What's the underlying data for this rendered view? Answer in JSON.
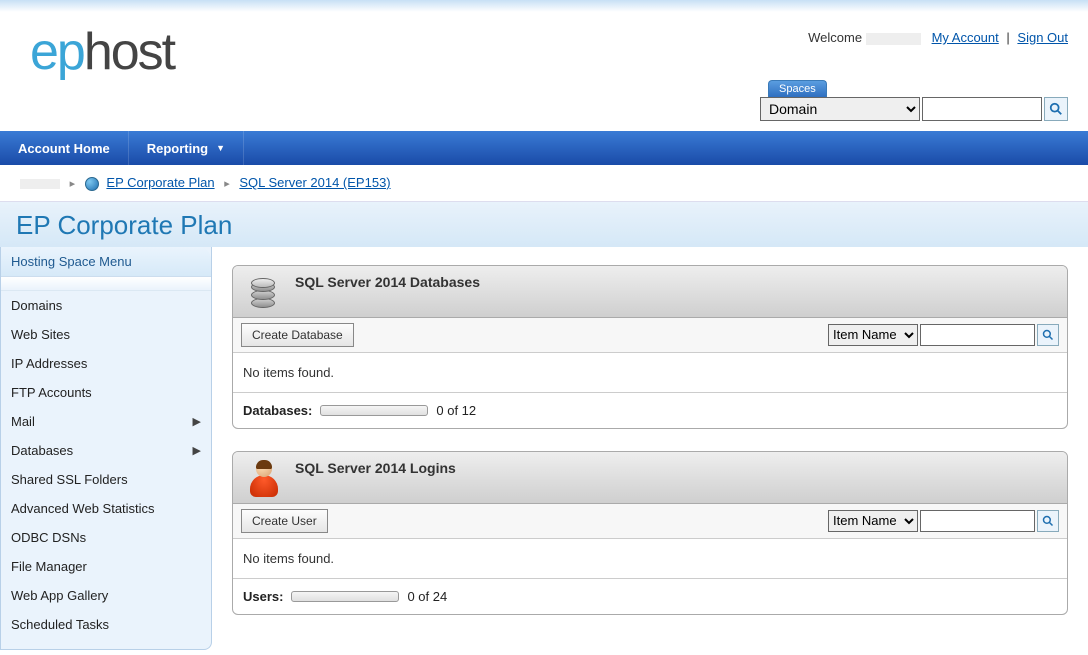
{
  "header": {
    "welcome": "Welcome",
    "my_account": "My Account",
    "sign_out": "Sign Out",
    "spaces_tab": "Spaces",
    "search_select_options": [
      "Domain"
    ],
    "search_value": ""
  },
  "topnav": {
    "items": [
      {
        "label": "Account Home",
        "has_dropdown": false
      },
      {
        "label": "Reporting",
        "has_dropdown": true
      }
    ]
  },
  "breadcrumbs": {
    "items": [
      {
        "label": "EP Corporate Plan"
      },
      {
        "label": "SQL Server 2014 (EP153)"
      }
    ]
  },
  "page_title": "EP Corporate Plan",
  "sidebar": {
    "header": "Hosting Space Menu",
    "items": [
      {
        "label": "Domains",
        "arrow": false
      },
      {
        "label": "Web Sites",
        "arrow": false
      },
      {
        "label": "IP Addresses",
        "arrow": false
      },
      {
        "label": "FTP Accounts",
        "arrow": false
      },
      {
        "label": "Mail",
        "arrow": true
      },
      {
        "label": "Databases",
        "arrow": true
      },
      {
        "label": "Shared SSL Folders",
        "arrow": false
      },
      {
        "label": "Advanced Web Statistics",
        "arrow": false
      },
      {
        "label": "ODBC DSNs",
        "arrow": false
      },
      {
        "label": "File Manager",
        "arrow": false
      },
      {
        "label": "Web App Gallery",
        "arrow": false
      },
      {
        "label": "Scheduled Tasks",
        "arrow": false
      }
    ]
  },
  "panels": [
    {
      "title": "SQL Server 2014 Databases",
      "create_label": "Create Database",
      "filter_options": [
        "Item Name"
      ],
      "filter_value": "",
      "empty_text": "No items found.",
      "quota_label": "Databases:",
      "quota_text": "0 of 12"
    },
    {
      "title": "SQL Server 2014 Logins",
      "create_label": "Create User",
      "filter_options": [
        "Item Name"
      ],
      "filter_value": "",
      "empty_text": "No items found.",
      "quota_label": "Users:",
      "quota_text": "0 of 24"
    }
  ]
}
